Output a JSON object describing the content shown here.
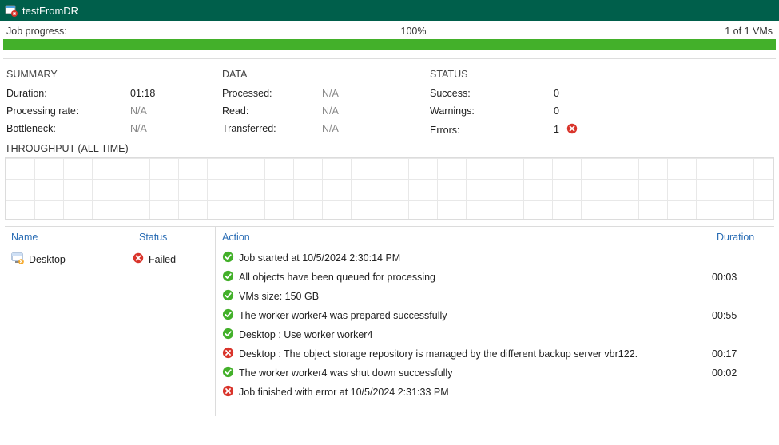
{
  "window": {
    "title": "testFromDR"
  },
  "progress": {
    "label": "Job progress:",
    "percent": "100%",
    "vms": "1 of 1 VMs"
  },
  "summary": {
    "heading": "SUMMARY",
    "duration_label": "Duration:",
    "duration_value": "01:18",
    "rate_label": "Processing rate:",
    "rate_value": "N/A",
    "bottleneck_label": "Bottleneck:",
    "bottleneck_value": "N/A"
  },
  "data": {
    "heading": "DATA",
    "processed_label": "Processed:",
    "processed_value": "N/A",
    "read_label": "Read:",
    "read_value": "N/A",
    "transferred_label": "Transferred:",
    "transferred_value": "N/A"
  },
  "status": {
    "heading": "STATUS",
    "success_label": "Success:",
    "success_value": "0",
    "warnings_label": "Warnings:",
    "warnings_value": "0",
    "errors_label": "Errors:",
    "errors_value": "1"
  },
  "throughput_label": "THROUGHPUT (ALL TIME)",
  "left": {
    "h_name": "Name",
    "h_status": "Status",
    "item_name": "Desktop",
    "item_status": "Failed"
  },
  "right": {
    "h_action": "Action",
    "h_duration": "Duration"
  },
  "log": [
    {
      "icon": "ok",
      "text": "Job started at 10/5/2024 2:30:14 PM",
      "dur": ""
    },
    {
      "icon": "ok",
      "text": "All objects have been queued for processing",
      "dur": "00:03"
    },
    {
      "icon": "ok",
      "text": "VMs size: 150 GB",
      "dur": ""
    },
    {
      "icon": "ok",
      "text": "The worker worker4 was prepared successfully",
      "dur": "00:55"
    },
    {
      "icon": "ok",
      "text": "Desktop : Use worker worker4",
      "dur": ""
    },
    {
      "icon": "err",
      "text": "Desktop : The object storage repository is managed by the different backup server vbr122.",
      "dur": "00:17"
    },
    {
      "icon": "ok",
      "text": "The worker worker4 was shut down successfully",
      "dur": "00:02"
    },
    {
      "icon": "err",
      "text": "Job finished with error at 10/5/2024 2:31:33 PM",
      "dur": ""
    }
  ]
}
